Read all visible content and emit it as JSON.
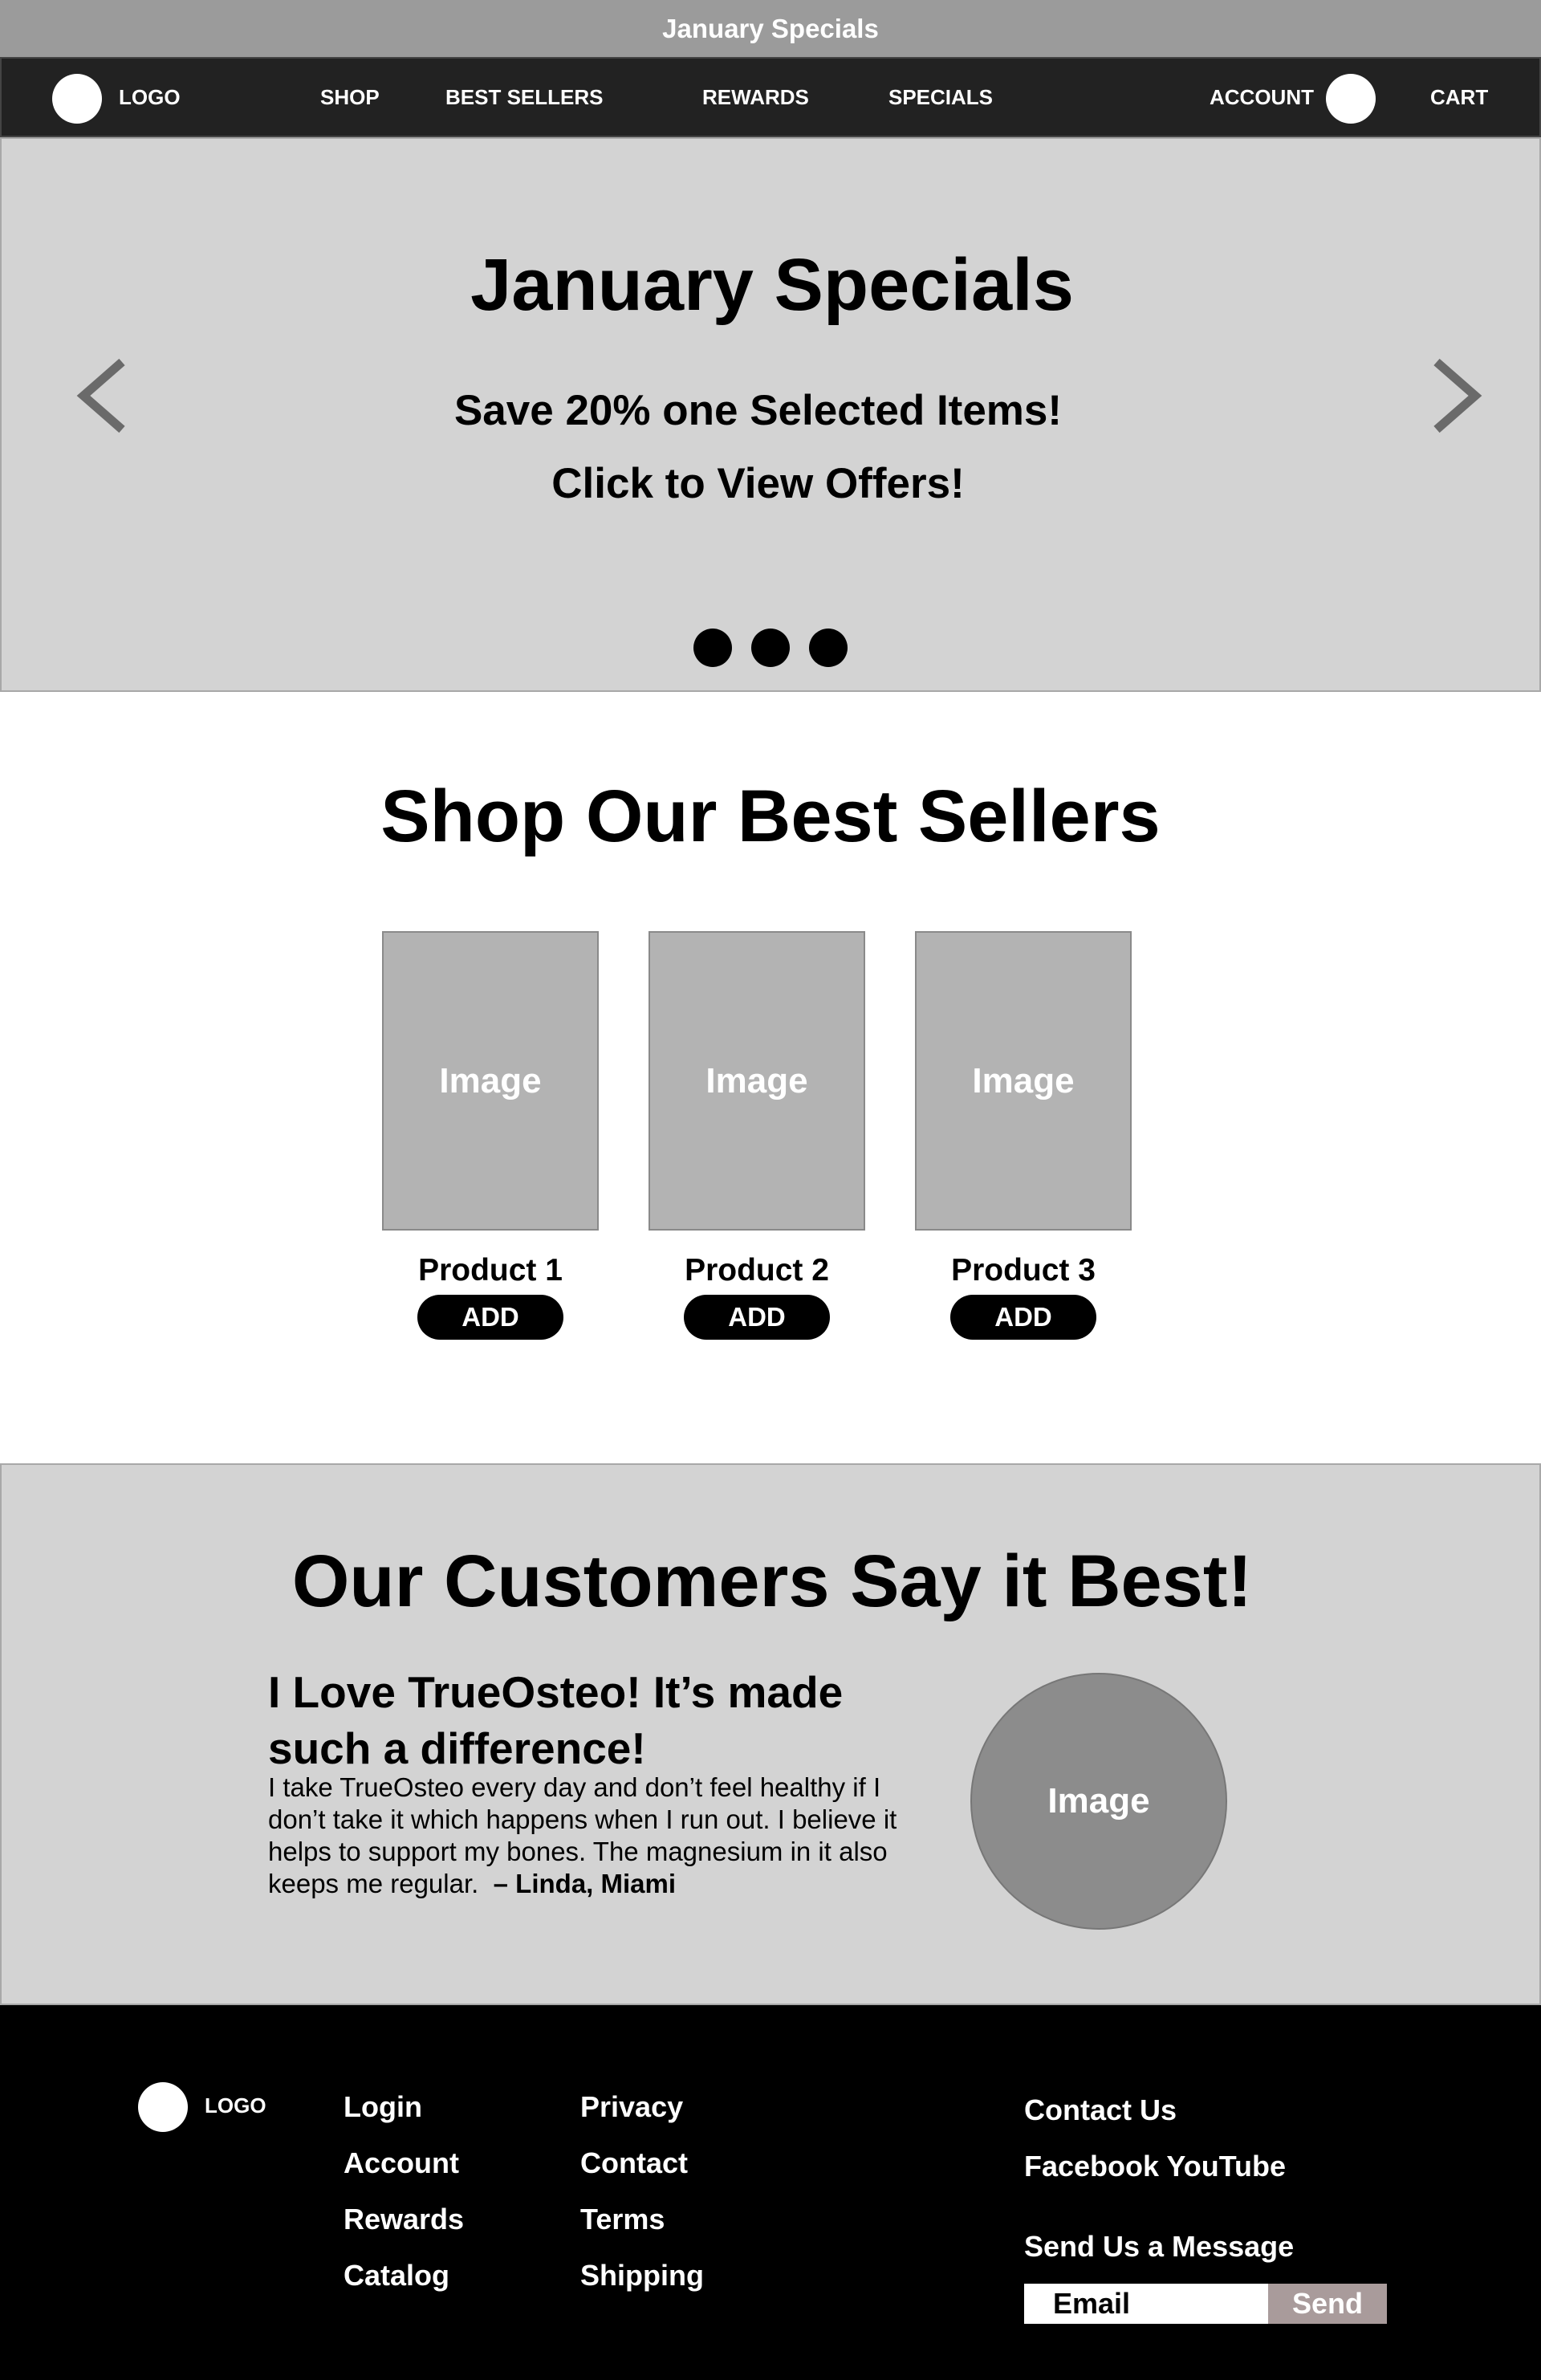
{
  "announcement": {
    "text": "January Specials"
  },
  "nav": {
    "logo_label": "LOGO",
    "items": [
      {
        "label": "SHOP"
      },
      {
        "label": "BEST SELLERS"
      },
      {
        "label": "REWARDS"
      },
      {
        "label": "SPECIALS"
      }
    ],
    "account_label": "ACCOUNT",
    "cart_label": "CART"
  },
  "hero": {
    "title": "January Specials",
    "line1": "Save 20% one Selected Items!",
    "line2": "Click to View Offers!",
    "prev_icon": "chevron-left-icon",
    "next_icon": "chevron-right-icon",
    "dots": 3
  },
  "best_sellers": {
    "title": "Shop Our Best Sellers",
    "products": [
      {
        "image_label": "Image",
        "name": "Product 1",
        "button": "ADD"
      },
      {
        "image_label": "Image",
        "name": "Product 2",
        "button": "ADD"
      },
      {
        "image_label": "Image",
        "name": "Product 3",
        "button": "ADD"
      }
    ]
  },
  "testimonials": {
    "title": "Our Customers Say it Best!",
    "quote_title": "I Love TrueOsteo! It’s made such a difference!",
    "quote_body": "I take TrueOsteo every day and don’t feel healthy if I don’t take it which happens when I run out. I believe it helps to support my bones. The magnesium in it also keeps me regular.",
    "author": "– Linda, Miami",
    "image_label": "Image"
  },
  "footer": {
    "logo_label": "LOGO",
    "col1": [
      "Login",
      "Account",
      "Rewards",
      "Catalog"
    ],
    "col2": [
      "Privacy",
      "Contact",
      "Terms",
      "Shipping"
    ],
    "contact_us": "Contact Us",
    "social": "Facebook YouTube",
    "message_header": "Send Us a Message",
    "email_placeholder": "Email",
    "send_label": "Send"
  },
  "colors": {
    "announcement_bg": "#9b9b9b",
    "nav_bg": "#222222",
    "section_bg": "#d3d3d3",
    "footer_bg": "#000000",
    "send_button_bg": "#a99b9b"
  }
}
